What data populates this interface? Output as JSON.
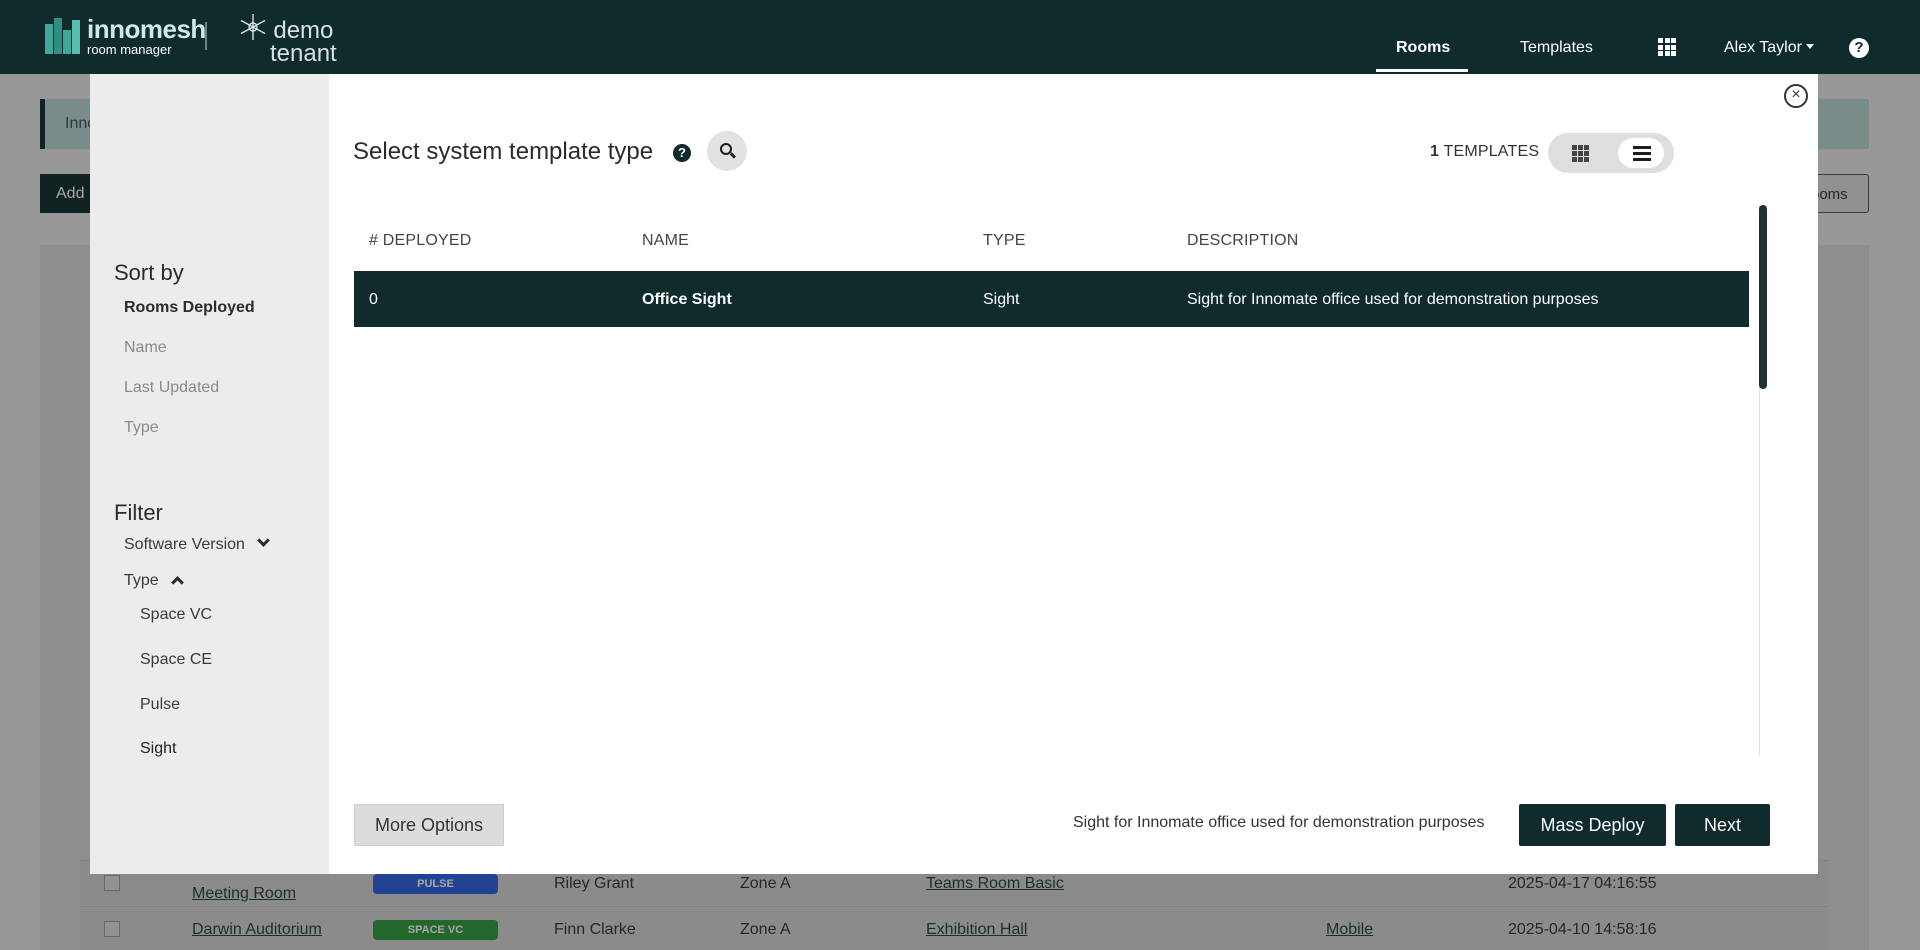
{
  "navbar": {
    "brand_name": "innomesh",
    "brand_sub": "room manager",
    "tenant_line1": "demo",
    "tenant_line2": "tenant",
    "rooms": "Rooms",
    "templates": "Templates",
    "user": "Alex Taylor",
    "help": "?"
  },
  "background": {
    "banner_text": "Inno",
    "add_button": "Add",
    "rooms_button": "ooms",
    "rows": [
      {
        "name": "Meeting Room",
        "badge": "PULSE",
        "badge_color": "#2b5fe0",
        "owner": "Riley Grant",
        "zone": "Zone A",
        "template": "Teams Room Basic",
        "extra": "",
        "date": "2025-04-17 04:16:55"
      },
      {
        "name": "Darwin Auditorium",
        "badge": "SPACE VC",
        "badge_color": "#2e9a3a",
        "owner": "Finn Clarke",
        "zone": "Zone A",
        "template": "Exhibition Hall",
        "extra": "Mobile",
        "date": "2025-04-10 14:58:16"
      }
    ]
  },
  "modal": {
    "title": "Select system template type",
    "template_count_number": "1",
    "template_count_label": "TEMPLATES",
    "sidebar": {
      "sort_heading": "Sort by",
      "sort_items": [
        "Rooms Deployed",
        "Name",
        "Last Updated",
        "Type"
      ],
      "filter_heading": "Filter",
      "software_version": "Software Version",
      "type": "Type",
      "type_options": [
        "Space VC",
        "Space CE",
        "Pulse",
        "Sight"
      ]
    },
    "table": {
      "headers": [
        "# DEPLOYED",
        "NAME",
        "TYPE",
        "DESCRIPTION"
      ],
      "rows": [
        {
          "deployed": "0",
          "name": "Office Sight",
          "type": "Sight",
          "description": "Sight for Innomate office used for demonstration purposes"
        }
      ]
    },
    "footer": {
      "more_options": "More Options",
      "selected_description": "Sight for Innomate office used for demonstration purposes",
      "mass_deploy": "Mass Deploy",
      "next": "Next"
    }
  },
  "colors": {
    "navbar": "#0f2b2b",
    "accent": "#0f2b2b",
    "selected_row": "#0f2b2b"
  }
}
